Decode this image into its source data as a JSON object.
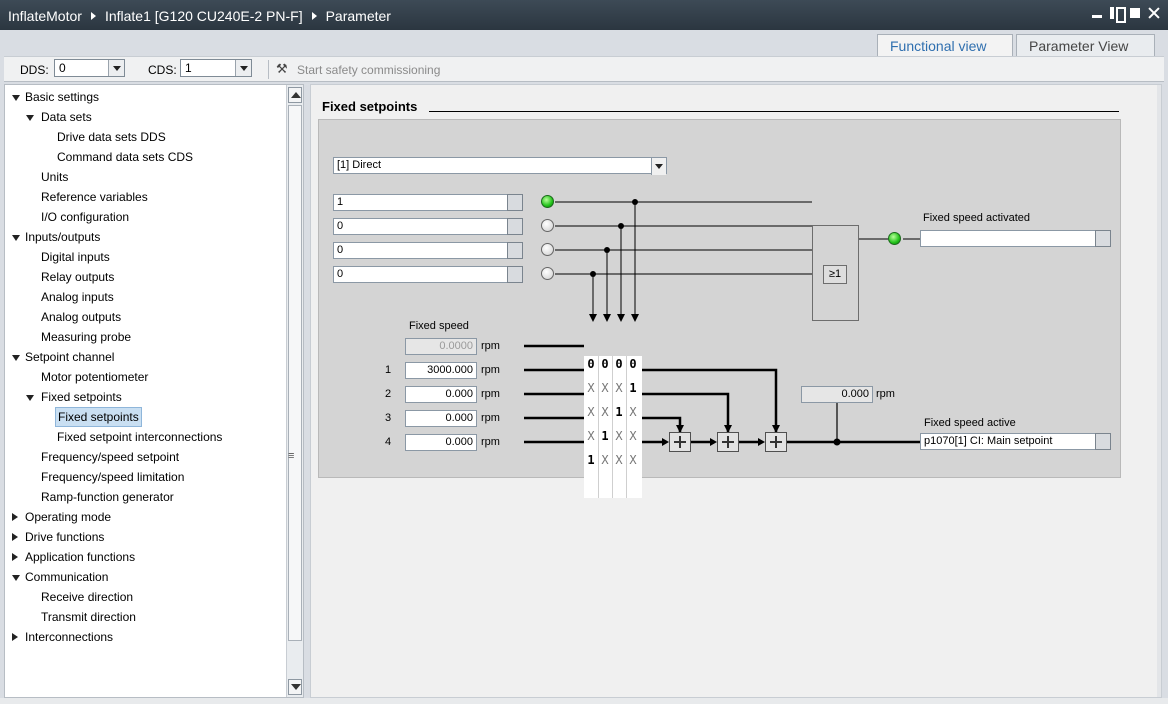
{
  "titlebar": {
    "crumbs": [
      "InflateMotor",
      "Inflate1 [G120 CU240E-2 PN-F]",
      "Parameter"
    ]
  },
  "view_tabs": [
    {
      "label": "Functional view",
      "active": true
    },
    {
      "label": "Parameter View",
      "active": false
    }
  ],
  "toolbar": {
    "dds_label": "DDS:",
    "dds_value": "0",
    "cds_label": "CDS:",
    "cds_value": "1",
    "safety_label": "Start safety commissioning"
  },
  "nav": [
    {
      "label": "Basic settings",
      "level": 0,
      "toggle": "open"
    },
    {
      "label": "Data sets",
      "level": 1,
      "toggle": "open"
    },
    {
      "label": "Drive data sets DDS",
      "level": 2
    },
    {
      "label": "Command data sets CDS",
      "level": 2
    },
    {
      "label": "Units",
      "level": 1
    },
    {
      "label": "Reference variables",
      "level": 1
    },
    {
      "label": "I/O configuration",
      "level": 1
    },
    {
      "label": "Inputs/outputs",
      "level": 0,
      "toggle": "open"
    },
    {
      "label": "Digital inputs",
      "level": 1
    },
    {
      "label": "Relay outputs",
      "level": 1
    },
    {
      "label": "Analog inputs",
      "level": 1
    },
    {
      "label": "Analog outputs",
      "level": 1
    },
    {
      "label": "Measuring probe",
      "level": 1
    },
    {
      "label": "Setpoint channel",
      "level": 0,
      "toggle": "open"
    },
    {
      "label": "Motor potentiometer",
      "level": 1
    },
    {
      "label": "Fixed setpoints",
      "level": 1,
      "toggle": "open"
    },
    {
      "label": "Fixed setpoints",
      "level": 2,
      "selected": true
    },
    {
      "label": "Fixed setpoint interconnections",
      "level": 2
    },
    {
      "label": "Frequency/speed setpoint",
      "level": 1
    },
    {
      "label": "Frequency/speed limitation",
      "level": 1
    },
    {
      "label": "Ramp-function generator",
      "level": 1
    },
    {
      "label": "Operating mode",
      "level": 0,
      "toggle": "closed"
    },
    {
      "label": "Drive functions",
      "level": 0,
      "toggle": "closed"
    },
    {
      "label": "Application functions",
      "level": 0,
      "toggle": "closed"
    },
    {
      "label": "Communication",
      "level": 0,
      "toggle": "open"
    },
    {
      "label": "Receive direction",
      "level": 1
    },
    {
      "label": "Transmit direction",
      "level": 1
    },
    {
      "label": "Interconnections",
      "level": 0,
      "toggle": "closed"
    }
  ],
  "main": {
    "section_title": "Fixed setpoints",
    "mode_select": "[1] Direct",
    "bit_inputs": [
      "1",
      "0",
      "0",
      "0"
    ],
    "bit_led_states": [
      "on",
      "off",
      "off",
      "off"
    ],
    "or_gate": "≥1",
    "fixed_speed_activated_label": "Fixed speed activated",
    "fixed_speed_activated_value": "",
    "fixed_speed_activated_led": "on",
    "fixed_speed_header": "Fixed speed",
    "speeds": [
      {
        "index": "",
        "value": "0.0000",
        "unit": "rpm",
        "disabled": true
      },
      {
        "index": "1",
        "value": "3000.000",
        "unit": "rpm"
      },
      {
        "index": "2",
        "value": "0.000",
        "unit": "rpm"
      },
      {
        "index": "3",
        "value": "0.000",
        "unit": "rpm"
      },
      {
        "index": "4",
        "value": "0.000",
        "unit": "rpm"
      }
    ],
    "matrix": [
      [
        "0",
        "0",
        "0",
        "0"
      ],
      [
        "X",
        "X",
        "X",
        "1"
      ],
      [
        "X",
        "X",
        "1",
        "X"
      ],
      [
        "X",
        "1",
        "X",
        "X"
      ],
      [
        "1",
        "X",
        "X",
        "X"
      ]
    ],
    "sum_value": "0.000",
    "sum_unit": "rpm",
    "fixed_speed_active_label": "Fixed speed active",
    "fixed_speed_active_value": "p1070[1] CI: Main setpoint"
  },
  "colors": {
    "titlebar": "#2b3640",
    "tab_active_text": "#2f6faf",
    "led_on": "#22c21a",
    "selected_item": "#c9dff2"
  }
}
